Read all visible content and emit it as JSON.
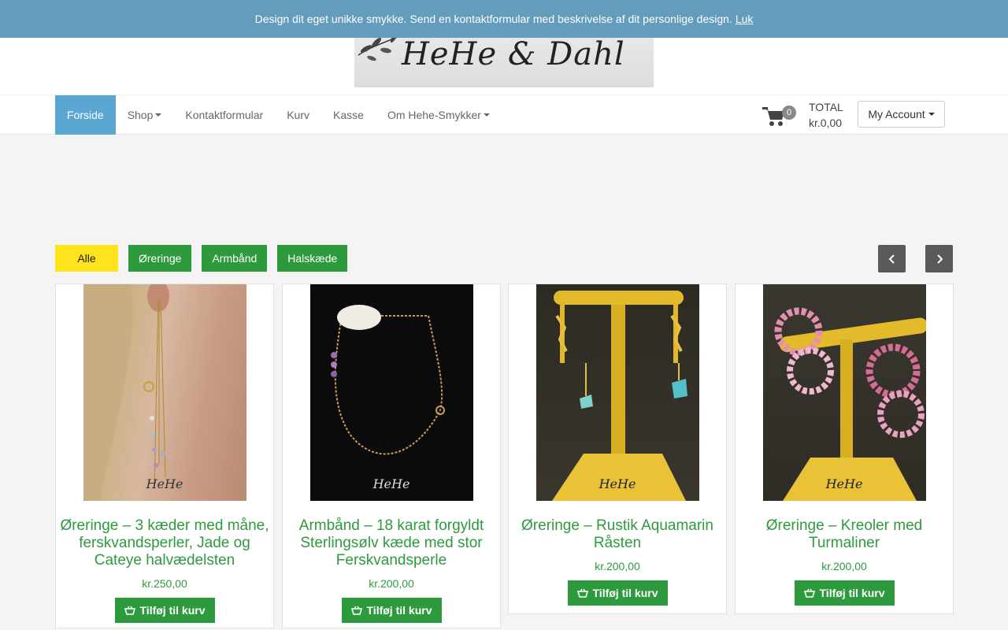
{
  "notice": {
    "text": "Design dit eget unikke smykke. Send en kontaktformular med beskrivelse af dit personlige design.",
    "close_label": "Luk"
  },
  "logo": {
    "text": "HeHe & Dahl"
  },
  "nav": {
    "items": [
      {
        "label": "Forside"
      },
      {
        "label": "Shop"
      },
      {
        "label": "Kontaktformular"
      },
      {
        "label": "Kurv"
      },
      {
        "label": "Kasse"
      },
      {
        "label": "Om Hehe-Smykker"
      }
    ]
  },
  "cart": {
    "count": "0",
    "total_label": "TOTAL",
    "total_value": "kr.0,00"
  },
  "account": {
    "label": "My Account"
  },
  "filters": [
    {
      "label": "Alle"
    },
    {
      "label": "Øreringe"
    },
    {
      "label": "Armbånd"
    },
    {
      "label": "Halskæde"
    }
  ],
  "products": [
    {
      "title": "Øreringe – 3 kæder med måne, ferskvandsperler, Jade og Cateye halvædelsten",
      "price": "kr.250,00",
      "button": "Tilføj til kurv",
      "watermark": "HeHe"
    },
    {
      "title": "Armbånd – 18 karat forgyldt Sterlingsølv kæde med stor Ferskvandsperle",
      "price": "kr.200,00",
      "button": "Tilføj til kurv",
      "watermark": "HeHe"
    },
    {
      "title": "Øreringe – Rustik Aquamarin Råsten",
      "price": "kr.200,00",
      "button": "Tilføj til kurv",
      "watermark": "HeHe"
    },
    {
      "title": "Øreringe – Kreoler med Turmaliner",
      "price": "kr.200,00",
      "button": "Tilføj til kurv",
      "watermark": "HeHe"
    }
  ],
  "colors": {
    "notice_bg": "#649cbb",
    "nav_active": "#5aa7d4",
    "green": "#2e9a3e",
    "filter_active": "#ffe41b"
  }
}
